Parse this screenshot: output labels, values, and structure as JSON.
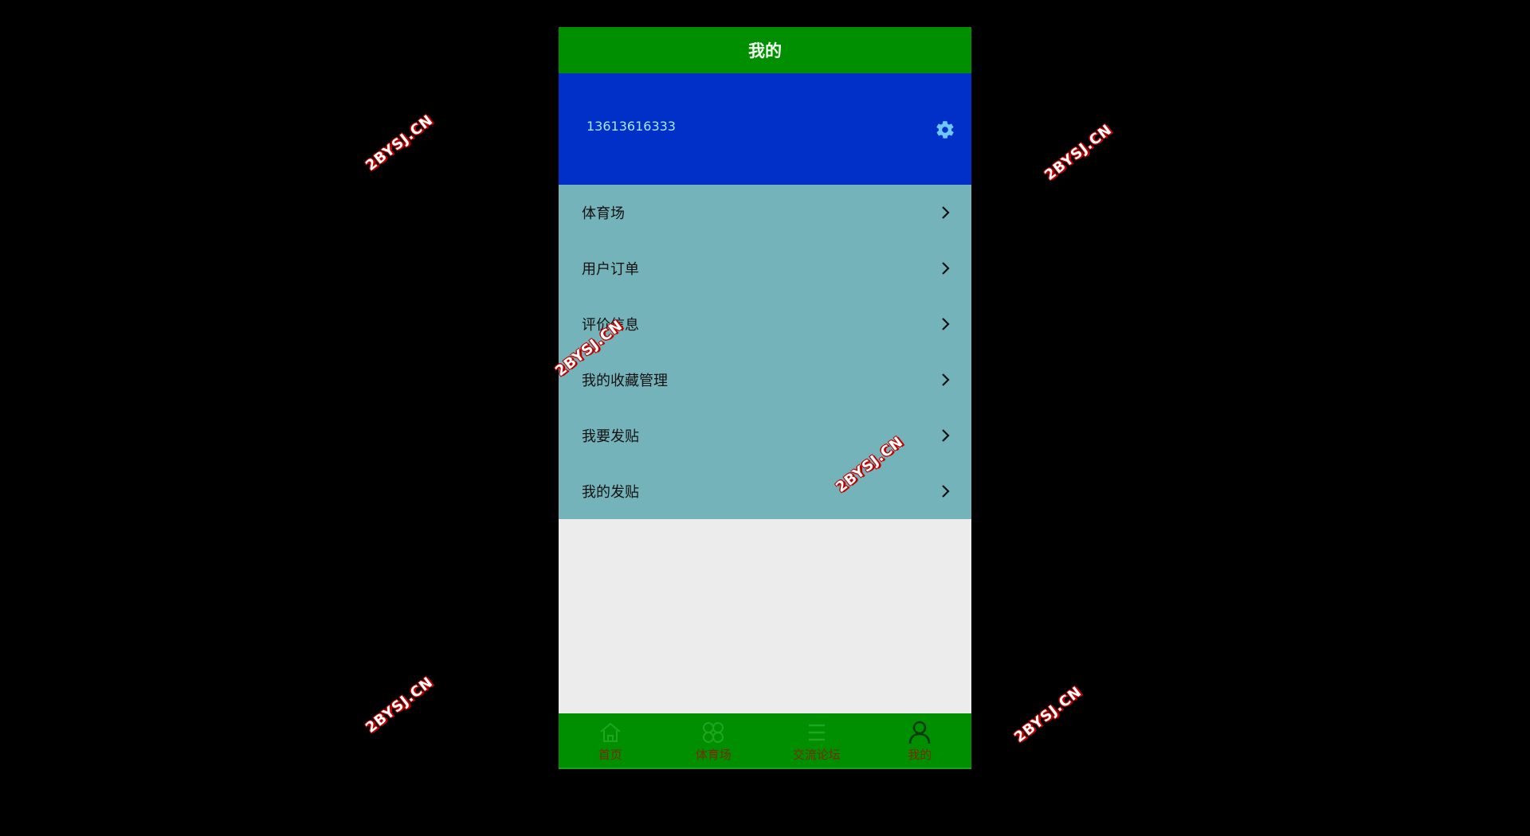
{
  "header": {
    "title": "我的"
  },
  "user": {
    "phone": "13613616333",
    "settings_icon": "gear-icon"
  },
  "menu": {
    "items": [
      {
        "label": "体育场",
        "icon": "chevron-right-icon"
      },
      {
        "label": "用户订单",
        "icon": "chevron-right-icon"
      },
      {
        "label": "评价信息",
        "icon": "chevron-right-icon"
      },
      {
        "label": "我的收藏管理",
        "icon": "chevron-right-icon"
      },
      {
        "label": "我要发贴",
        "icon": "chevron-right-icon"
      },
      {
        "label": "我的发贴",
        "icon": "chevron-right-icon"
      }
    ]
  },
  "tabbar": {
    "items": [
      {
        "label": "首页",
        "icon": "home-icon",
        "active": false
      },
      {
        "label": "体育场",
        "icon": "grid-icon",
        "active": false
      },
      {
        "label": "交流论坛",
        "icon": "list-icon",
        "active": false
      },
      {
        "label": "我的",
        "icon": "person-icon",
        "active": true
      }
    ]
  },
  "watermark": {
    "text": "2BYSJ.CN"
  },
  "colors": {
    "page_background": "#000000",
    "title_bar": "#008f00",
    "user_panel": "#0030c8",
    "menu_background": "#74b3b9",
    "content_background": "#ececec",
    "tab_bar": "#008f00",
    "tab_label": "#7a2a00"
  }
}
